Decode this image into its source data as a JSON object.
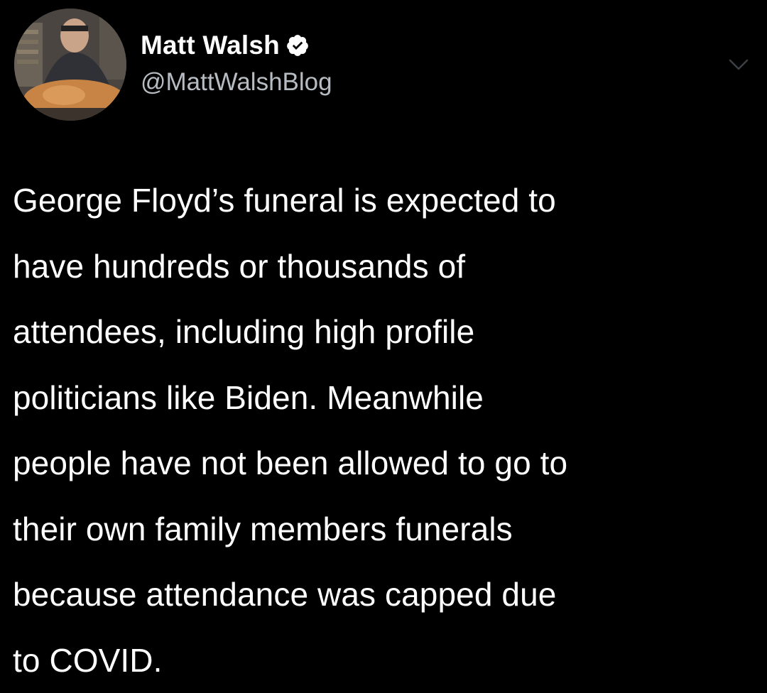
{
  "tweet": {
    "author": {
      "display_name": "Matt Walsh",
      "handle": "@MattWalshBlog",
      "verified": true,
      "verified_icon": "verified-badge-icon"
    },
    "menu_icon": "chevron-down-icon",
    "text_lines": [
      "George Floyd’s funeral is expected to",
      "have hundreds or thousands of",
      "attendees, including high profile",
      "politicians like Biden. Meanwhile",
      "people have not been allowed to go to",
      "their own family members funerals",
      "because attendance was capped due",
      "to COVID."
    ]
  },
  "colors": {
    "background": "#000000",
    "text": "#ffffff",
    "handle": "#b7bcc2",
    "verified_badge": "#ffffff"
  }
}
